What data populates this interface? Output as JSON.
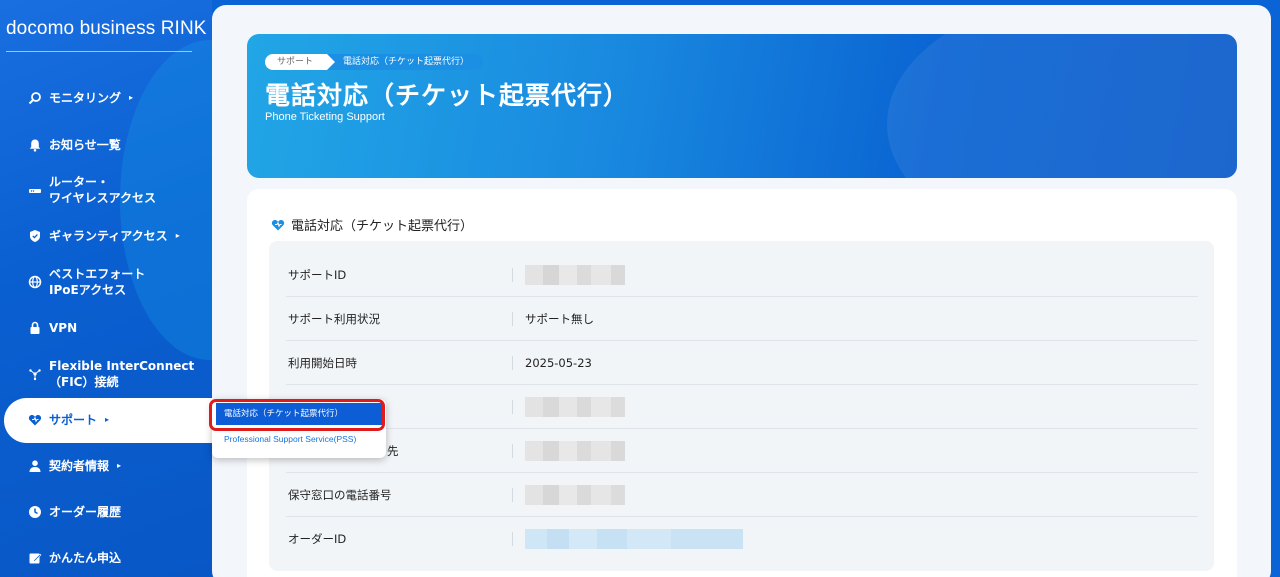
{
  "sidebar": {
    "brand": "docomo business RINK",
    "items": [
      {
        "label": "モニタリング",
        "icon": "monitoring-search-icon",
        "arrow": "▸"
      },
      {
        "label": "お知らせ一覧",
        "icon": "bell-icon"
      },
      {
        "label": "ルーター・\nワイヤレスアクセス",
        "icon": "router-icon"
      },
      {
        "label": "ギャランティアクセス",
        "icon": "shield-icon",
        "arrow": "▸"
      },
      {
        "label": "ベストエフォート\nIPoEアクセス",
        "icon": "globe-icon"
      },
      {
        "label": "VPN",
        "icon": "lock-icon"
      },
      {
        "label": "Flexible InterConnect\n（FIC）接続",
        "icon": "network-icon"
      },
      {
        "label": "サポート",
        "icon": "support-heart-icon",
        "arrow": "▸"
      },
      {
        "label": "契約者情報",
        "icon": "person-icon",
        "arrow": "▸"
      },
      {
        "label": "オーダー履歴",
        "icon": "clock-icon"
      },
      {
        "label": "かんたん申込",
        "icon": "edit-icon"
      }
    ]
  },
  "submenu": {
    "selected": "電話対応（チケット起票代行）",
    "option2": "Professional Support Service(PSS)"
  },
  "hero": {
    "breadcrumb": [
      "サポート",
      "電話対応（チケット起票代行）"
    ],
    "title": "電話対応（チケット起票代行）",
    "subtitle": "Phone Ticketing Support"
  },
  "card": {
    "heading": "電話対応（チケット起票代行）",
    "rows": [
      {
        "label": "サポートID",
        "value": ""
      },
      {
        "label": "サポート利用状況",
        "value": "サポート無し"
      },
      {
        "label": "利用開始日時",
        "value": "2025-05-23"
      },
      {
        "label": "",
        "value": ""
      },
      {
        "label": "先",
        "value": ""
      },
      {
        "label": "保守窓口の電話番号",
        "value": ""
      },
      {
        "label": "オーダーID",
        "value": ""
      }
    ]
  },
  "colors": {
    "sidebar": "#0a5fd0",
    "accent": "#0d5ed6",
    "highlight": "#e01b1b"
  }
}
